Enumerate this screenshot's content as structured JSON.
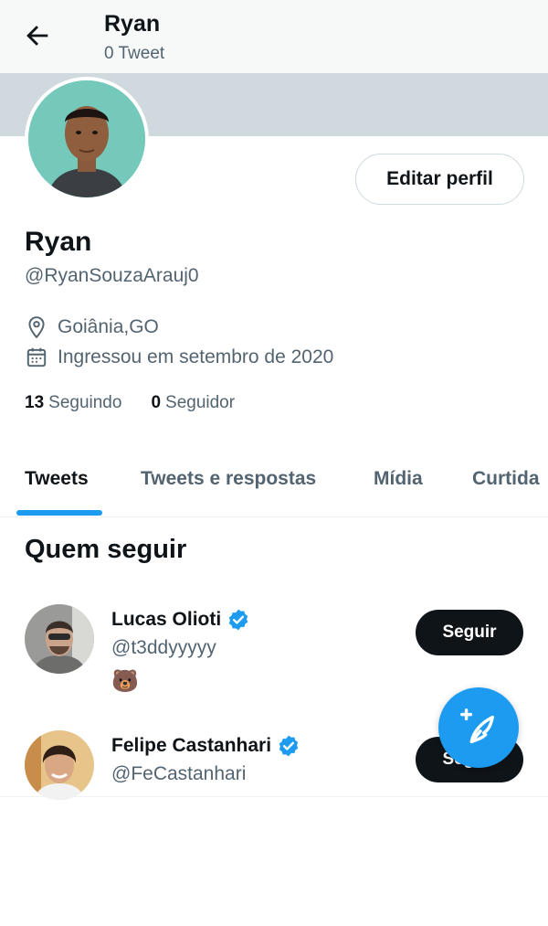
{
  "header": {
    "name": "Ryan",
    "tweet_count": "0 Tweet"
  },
  "profile": {
    "edit_button": "Editar perfil",
    "name": "Ryan",
    "handle": "@RyanSouzaArauj0",
    "location": "Goiânia,GO",
    "joined": "Ingressou em setembro de 2020",
    "following_count": "13",
    "following_label": "Seguindo",
    "followers_count": "0",
    "followers_label": "Seguidor"
  },
  "tabs": [
    {
      "label": "Tweets",
      "active": true
    },
    {
      "label": "Tweets e respostas",
      "active": false
    },
    {
      "label": "Mídia",
      "active": false
    },
    {
      "label": "Curtida",
      "active": false
    }
  ],
  "who_to_follow": {
    "title": "Quem seguir",
    "users": [
      {
        "name": "Lucas Olioti",
        "handle": "@t3ddyyyyy",
        "bio": "🐻",
        "button": "Seguir",
        "verified": true
      },
      {
        "name": "Felipe Castanhari",
        "handle": "@FeCastanhari",
        "button": "Seguir",
        "verified": true
      }
    ]
  },
  "icons": {
    "back": "arrow-left-icon",
    "location": "location-pin-icon",
    "calendar": "calendar-icon",
    "verified": "verified-badge-icon",
    "compose": "compose-tweet-icon"
  },
  "colors": {
    "accent": "#1d9bf0",
    "banner": "#cfd9de",
    "text_secondary": "#536471",
    "button_dark": "#0f1419"
  }
}
